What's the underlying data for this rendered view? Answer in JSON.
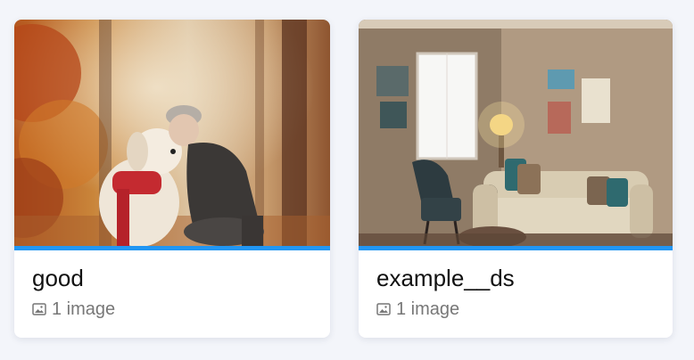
{
  "colors": {
    "accent": "#2196f3",
    "background": "#f3f5fa",
    "card": "#ffffff",
    "title": "#111111",
    "muted": "#777777"
  },
  "datasets": [
    {
      "name": "good",
      "count_label": "1 image",
      "thumbnail": "woman hugging white dog in autumn forest",
      "icon": "image-icon"
    },
    {
      "name": "example__ds",
      "count_label": "1 image",
      "thumbnail": "living room with sofa, lamp and armchair",
      "icon": "image-icon"
    }
  ]
}
